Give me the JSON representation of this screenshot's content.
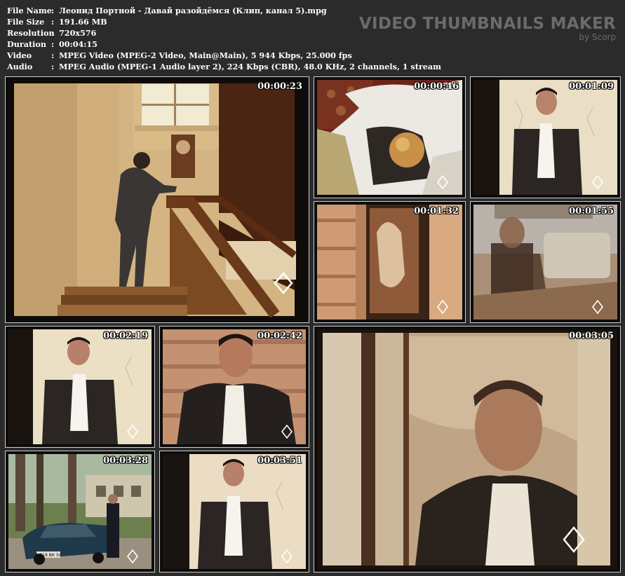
{
  "file_info": {
    "rows": [
      {
        "label": "File Name",
        "value": "Леонид Портной - Давай разойдёмся (Клип, канал 5).mpg"
      },
      {
        "label": "File Size",
        "value": "191.66 MB"
      },
      {
        "label": "Resolution",
        "value": "720x576"
      },
      {
        "label": "Duration",
        "value": "00:04:15"
      },
      {
        "label": "Video",
        "value": "MPEG Video (MPEG-2 Video, Main@Main), 5 944 Kbps, 25.000 fps"
      },
      {
        "label": "Audio",
        "value": "MPEG Audio (MPEG-1 Audio layer 2), 224 Kbps (CBR), 48.0 KHz, 2 channels, 1 stream"
      }
    ],
    "separator": ":"
  },
  "brand": {
    "title": "VIDEO THUMBNAILS MAKER",
    "subtitle": "by Scorp"
  },
  "thumbnails": [
    {
      "timestamp": "00:00:23",
      "scene": "staircase"
    },
    {
      "timestamp": "00:00:46",
      "scene": "still-life-apple"
    },
    {
      "timestamp": "00:01:09",
      "scene": "man-standing-wall"
    },
    {
      "timestamp": "00:01:32",
      "scene": "woman-in-window"
    },
    {
      "timestamp": "00:01:55",
      "scene": "man-double-exposure-room"
    },
    {
      "timestamp": "00:02:19",
      "scene": "man-standing-wall"
    },
    {
      "timestamp": "00:02:42",
      "scene": "man-closeup-logwall"
    },
    {
      "timestamp": "00:03:05",
      "scene": "man-behind-curtain"
    },
    {
      "timestamp": "00:03:28",
      "scene": "man-with-car"
    },
    {
      "timestamp": "00:03:51",
      "scene": "man-standing-wall"
    }
  ],
  "car_plate": "А 919 ВК 50",
  "colors": {
    "background": "#2b2b2b",
    "text": "#ffffff",
    "brand": "#6b6b6b",
    "thumb_border": "#cfcfcf"
  }
}
